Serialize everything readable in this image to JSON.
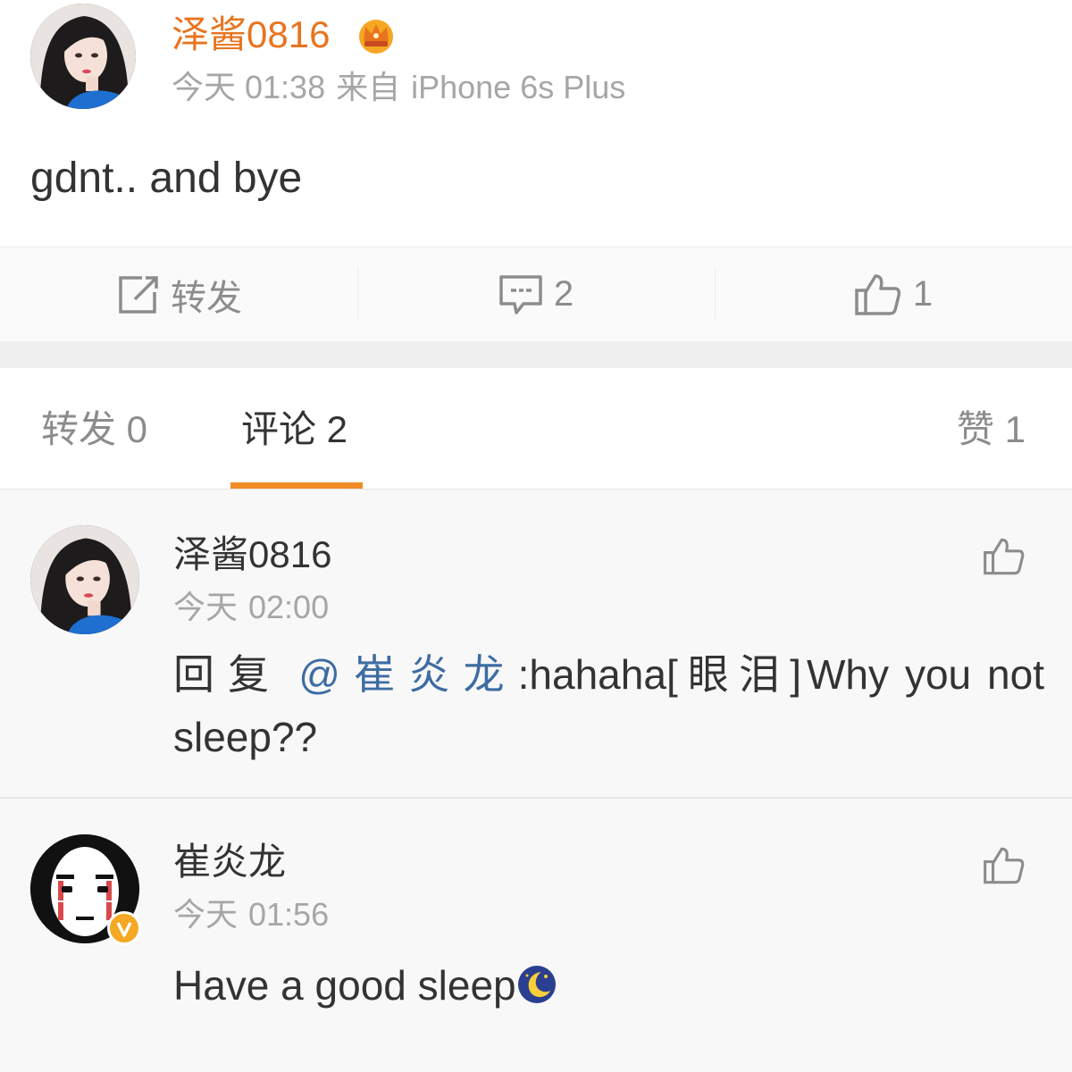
{
  "post": {
    "author": "泽酱0816",
    "badge_icon": "crown-icon",
    "time": "今天 01:38",
    "source_prefix": "来自",
    "source_device": "iPhone 6s Plus",
    "text": "gdnt.. and bye"
  },
  "actions": {
    "repost_label": "转发",
    "comment_count": "2",
    "like_count": "1"
  },
  "tabs": {
    "repost": "转发 0",
    "comment": "评论 2",
    "like": "赞 1"
  },
  "comments": [
    {
      "author": "泽酱0816",
      "time_day": "今天",
      "time_clock": "02:00",
      "reply_prefix": "回复",
      "mention": "@崔炎龙",
      "text_part1": ":hahaha",
      "emoticon_text": "[眼泪]",
      "text_part2": "Why you not sleep??"
    },
    {
      "author": "崔炎龙",
      "time_day": "今天",
      "time_clock": "01:56",
      "text": "Have a good sleep",
      "verified_icon": "verified-badge-icon",
      "emoji_icon": "moon-sleep-emoji-icon"
    }
  ],
  "colors": {
    "accent_orange": "#f08c25",
    "author_orange": "#e8741f",
    "mention_blue": "#3d6ca3",
    "meta_gray": "#a6a6a6"
  }
}
